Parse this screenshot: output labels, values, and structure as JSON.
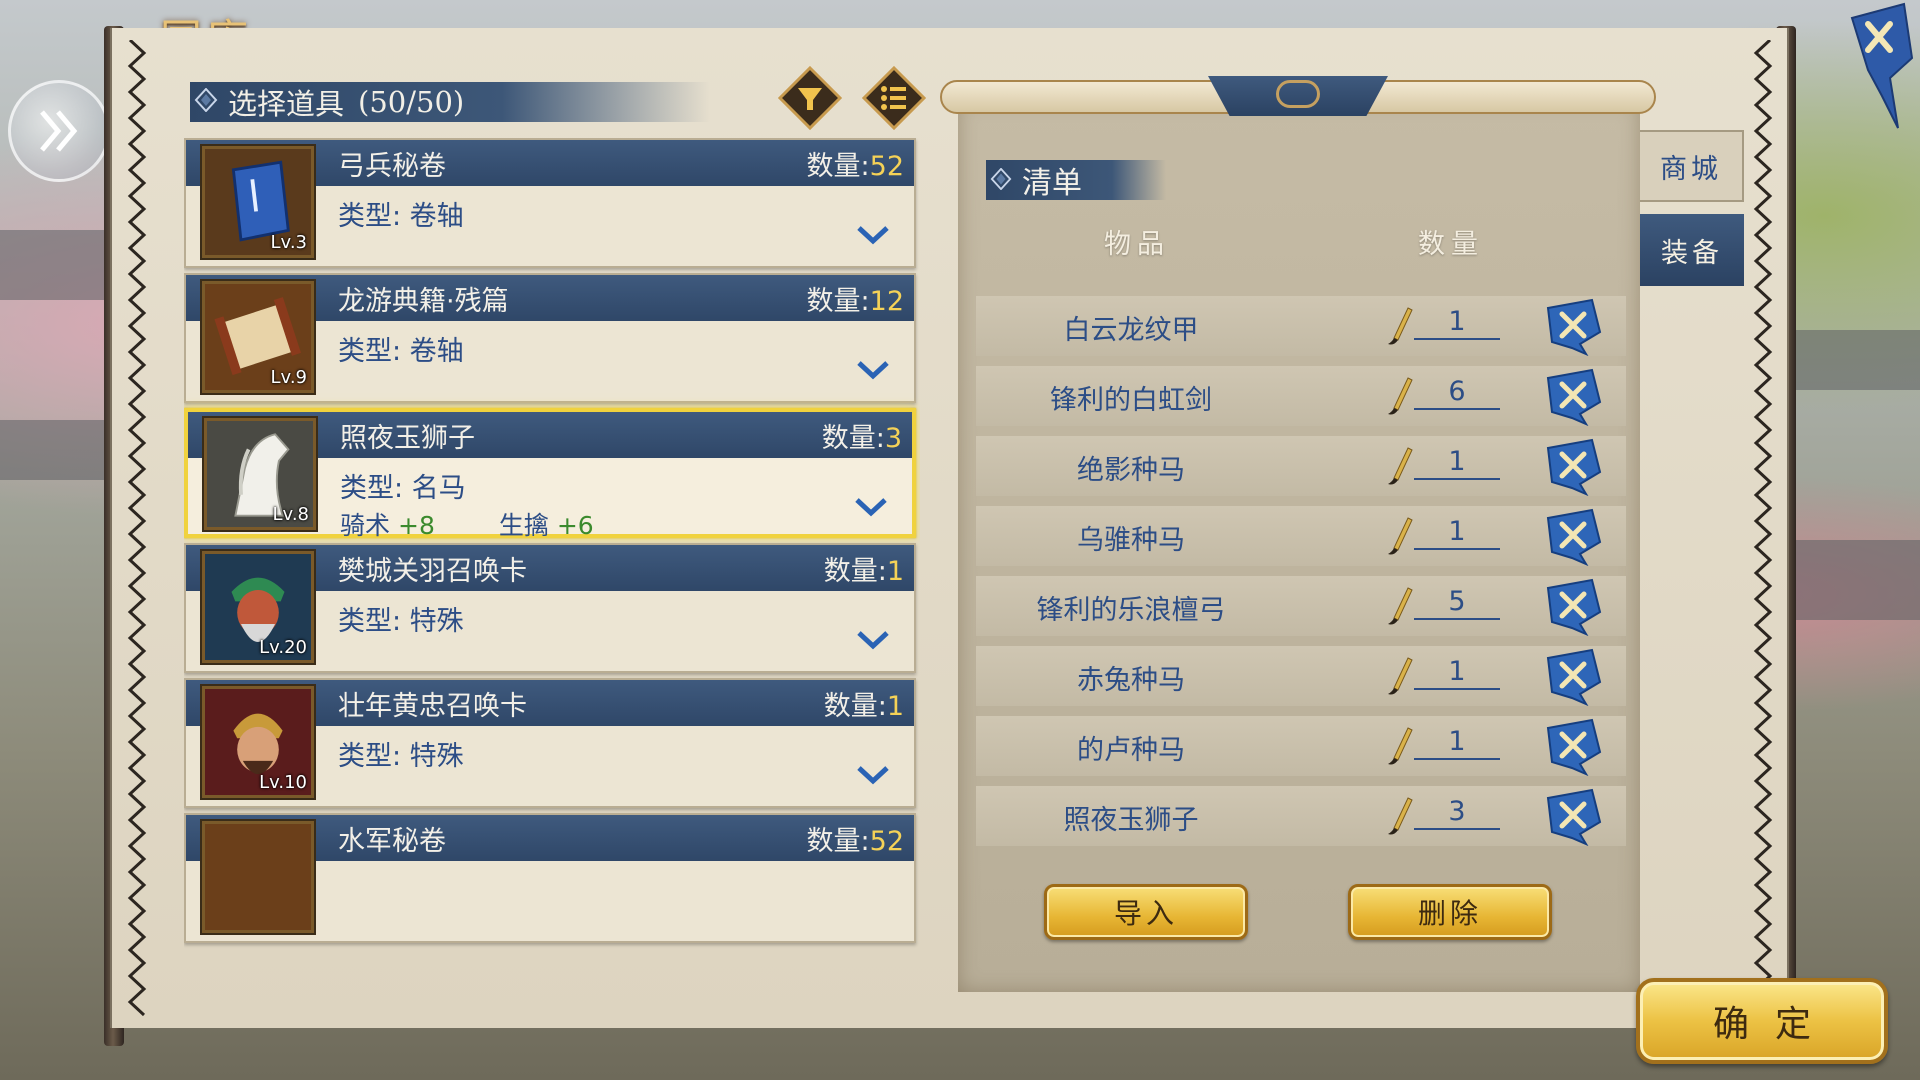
{
  "game_title": "国库",
  "select_header": {
    "label": "选择道具",
    "count": "(50/50)"
  },
  "items": [
    {
      "name": "弓兵秘卷",
      "qty_label": "数量:",
      "qty": "52",
      "type": "类型: 卷轴",
      "level": "Lv.3",
      "icon": "blue-book-icon"
    },
    {
      "name": "龙游典籍·残篇",
      "qty_label": "数量:",
      "qty": "12",
      "type": "类型: 卷轴",
      "level": "Lv.9",
      "icon": "scroll-icon"
    },
    {
      "name": "照夜玉狮子",
      "qty_label": "数量:",
      "qty": "3",
      "type": "类型: 名马",
      "level": "Lv.8",
      "icon": "white-horse-icon",
      "selected": true,
      "stat1_label": "骑术",
      "stat1_value": "+8",
      "stat2_label": "生擒",
      "stat2_value": "+6"
    },
    {
      "name": "樊城关羽召唤卡",
      "qty_label": "数量:",
      "qty": "1",
      "type": "类型: 特殊",
      "level": "Lv.20",
      "icon": "guan-yu-portrait-icon"
    },
    {
      "name": "壮年黄忠召唤卡",
      "qty_label": "数量:",
      "qty": "1",
      "type": "类型: 特殊",
      "level": "Lv.10",
      "icon": "huang-zhong-portrait-icon"
    },
    {
      "name": "水军秘卷",
      "qty_label": "数量:",
      "qty": "52",
      "type": "",
      "level": "",
      "icon": "scroll-icon"
    }
  ],
  "checklist": {
    "title": "清单",
    "col_item": "物品",
    "col_qty": "数量",
    "rows": [
      {
        "name": "白云龙纹甲",
        "qty": "1"
      },
      {
        "name": "锋利的白虹剑",
        "qty": "6"
      },
      {
        "name": "绝影种马",
        "qty": "1"
      },
      {
        "name": "乌骓种马",
        "qty": "1"
      },
      {
        "name": "锋利的乐浪檀弓",
        "qty": "5"
      },
      {
        "name": "赤兔种马",
        "qty": "1"
      },
      {
        "name": "的卢种马",
        "qty": "1"
      },
      {
        "name": "照夜玉狮子",
        "qty": "3"
      }
    ],
    "import_label": "导入",
    "delete_label": "删除"
  },
  "side_tabs": {
    "shop": "商城",
    "equip": "装备",
    "active": "equip"
  },
  "confirm_label": "确定",
  "colors": {
    "panel_blue": "#2f4768",
    "gold": "#e7b634",
    "text_blue": "#2c4d86",
    "stat_green": "#3b8a2d",
    "highlight": "#f0d23e"
  }
}
